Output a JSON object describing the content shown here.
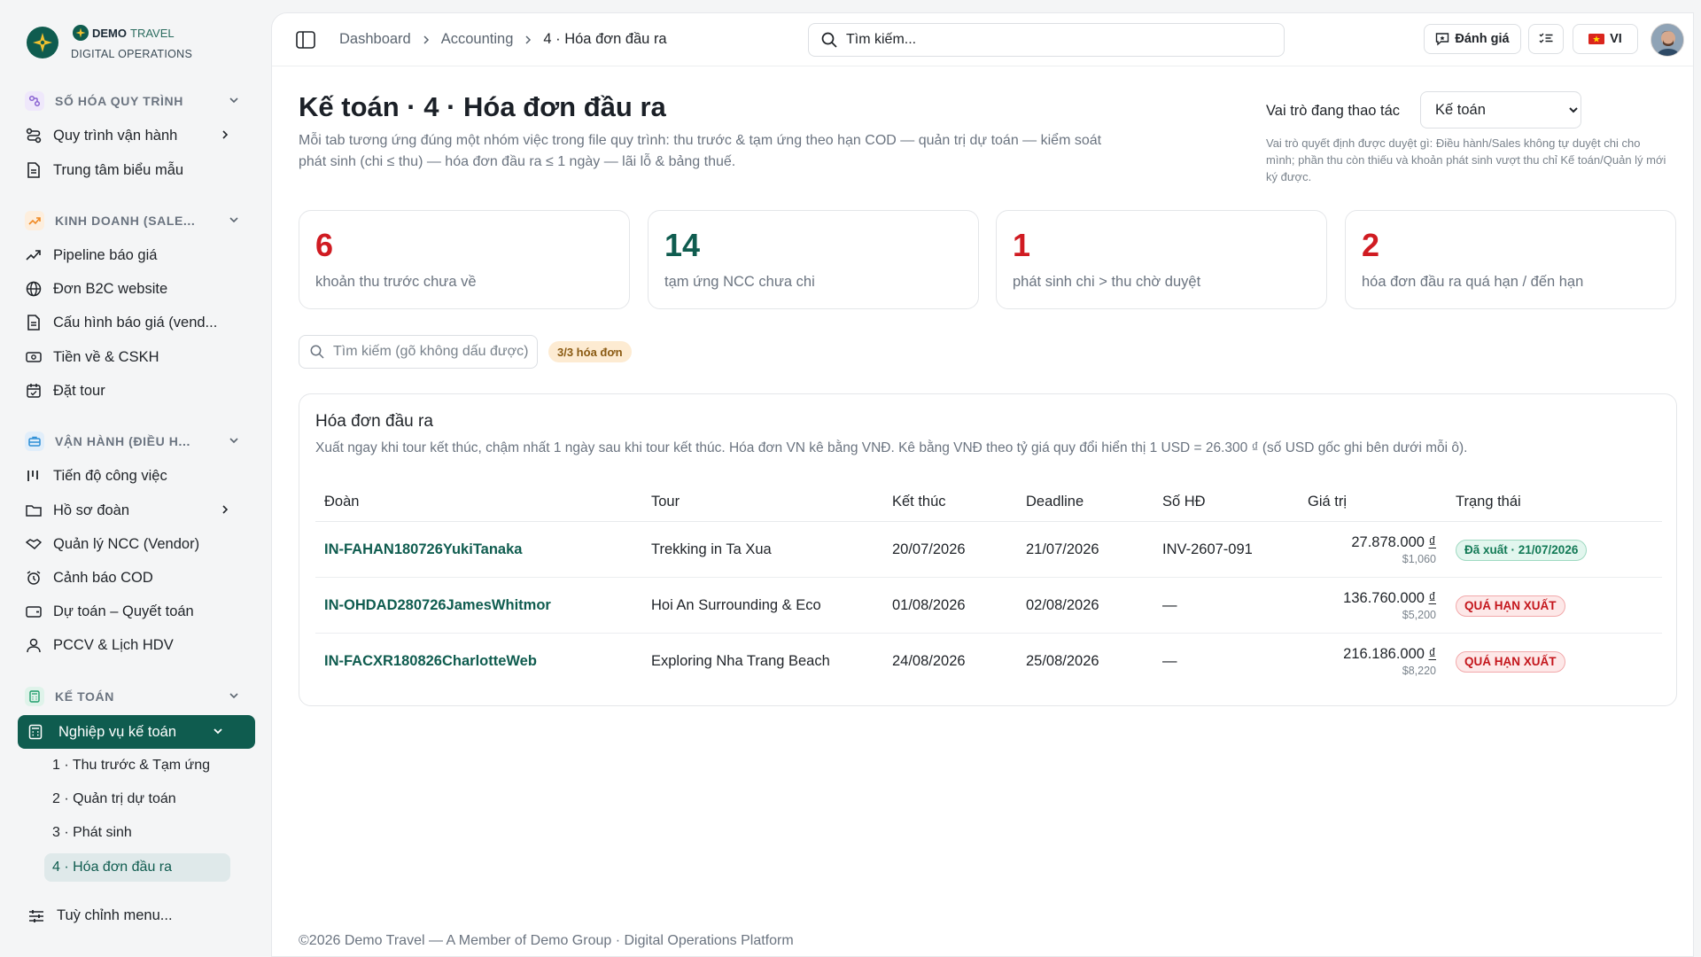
{
  "brand": {
    "name_bold": "DEMO",
    "name_light": "TRAVEL",
    "subtitle": "DIGITAL OPERATIONS"
  },
  "sidebar": {
    "sections": [
      {
        "label": "SỐ HÓA QUY TRÌNH",
        "icon": "workflow-icon",
        "color": "#8a63d2",
        "items": [
          {
            "label": "Quy trình vận hành",
            "icon": "workflow-steps-icon",
            "has_submenu": true
          },
          {
            "label": "Trung tâm biểu mẫu",
            "icon": "document-icon"
          }
        ]
      },
      {
        "label": "KINH DOANH (SALE...",
        "icon": "trend-up-icon",
        "color": "#f08a24",
        "items": [
          {
            "label": "Pipeline báo giá",
            "icon": "trend-up-icon"
          },
          {
            "label": "Đơn B2C website",
            "icon": "globe-icon"
          },
          {
            "label": "Cấu hình báo giá (vend...",
            "icon": "document-icon"
          },
          {
            "label": "Tiền về & CSKH",
            "icon": "money-icon"
          },
          {
            "label": "Đặt tour",
            "icon": "calendar-check-icon"
          }
        ]
      },
      {
        "label": "VẬN HÀNH (ĐIỀU H...",
        "icon": "briefcase-icon",
        "color": "#2f8fd6",
        "items": [
          {
            "label": "Tiến độ công việc",
            "icon": "bar-progress-icon"
          },
          {
            "label": "Hồ sơ đoàn",
            "icon": "folder-icon",
            "has_submenu": true
          },
          {
            "label": "Quản lý NCC (Vendor)",
            "icon": "handshake-icon"
          },
          {
            "label": "Cảnh báo COD",
            "icon": "alarm-icon"
          },
          {
            "label": "Dự toán – Quyết toán",
            "icon": "wallet-icon"
          },
          {
            "label": "PCCV & Lịch HDV",
            "icon": "user-icon"
          }
        ]
      },
      {
        "label": "KẾ TOÁN",
        "icon": "calculator-icon",
        "color": "#1f9d6b",
        "active_item": {
          "label": "Nghiệp vụ kế toán",
          "icon": "calculator-icon"
        },
        "subitems": [
          {
            "label": "1 · Thu trước & Tạm ứng"
          },
          {
            "label": "2 · Quản trị dự toán"
          },
          {
            "label": "3 · Phát sinh"
          },
          {
            "label": "4 · Hóa đơn đầu ra",
            "selected": true
          }
        ]
      }
    ],
    "customize_label": "Tuỳ chỉnh menu..."
  },
  "topbar": {
    "breadcrumb": [
      "Dashboard",
      "Accounting",
      "4 · Hóa đơn đầu ra"
    ],
    "search_placeholder": "Tìm kiếm...",
    "feedback_label": "Đánh giá",
    "language_label": "VI",
    "language_flag": "🇻🇳"
  },
  "page": {
    "title": "Kế toán · 4 · Hóa đơn đầu ra",
    "description": "Mỗi tab tương ứng đúng một nhóm việc trong file quy trình: thu trước & tạm ứng theo hạn COD — quản trị dự toán — kiểm soát phát sinh (chi ≤ thu) — hóa đơn đầu ra ≤ 1 ngày — lãi lỗ & bảng thuế.",
    "role_label": "Vai trò đang thao tác",
    "role_selected": "Kế toán",
    "role_options": [
      "Kế toán"
    ],
    "role_note": "Vai trò quyết định được duyệt gì: Điều hành/Sales không tự duyệt chi cho mình; phần thu còn thiếu và khoản phát sinh vượt thu chỉ Kế toán/Quản lý mới ký được."
  },
  "stats": [
    {
      "value": "6",
      "label": "khoản thu trước chưa về",
      "color": "#d01b22"
    },
    {
      "value": "14",
      "label": "tạm ứng NCC chưa chi",
      "color": "#0f5c4f"
    },
    {
      "value": "1",
      "label": "phát sinh chi > thu chờ duyệt",
      "color": "#d01b22"
    },
    {
      "value": "2",
      "label": "hóa đơn đầu ra quá hạn / đến hạn",
      "color": "#d01b22"
    }
  ],
  "filter": {
    "placeholder": "Tìm kiếm (gõ không dấu được)",
    "count_badge": "3/3 hóa đơn"
  },
  "invoices": {
    "title": "Hóa đơn đầu ra",
    "description": "Xuất ngay khi tour kết thúc, chậm nhất 1 ngày sau khi tour kết thúc. Hóa đơn VN kê bằng VNĐ. Kê bằng VNĐ theo tỷ giá quy đổi hiển thị 1 USD = 26.300 ₫ (số USD gốc ghi bên dưới mỗi ô).",
    "columns": [
      "Đoàn",
      "Tour",
      "Kết thúc",
      "Deadline",
      "Số HĐ",
      "Giá trị",
      "Trạng thái"
    ],
    "rows": [
      {
        "code": "IN-FAHAN180726YukiTanaka",
        "tour": "Trekking in Ta Xua",
        "end": "20/07/2026",
        "deadline": "21/07/2026",
        "invoice_no": "INV-2607-091",
        "vnd": "27.878.000",
        "currency": "₫",
        "usd": "$1,060",
        "status": "Đã xuất · 21/07/2026",
        "status_type": "ok"
      },
      {
        "code": "IN-OHDAD280726JamesWhitmor",
        "tour": "Hoi An Surrounding & Eco",
        "end": "01/08/2026",
        "deadline": "02/08/2026",
        "invoice_no": "—",
        "vnd": "136.760.000",
        "currency": "₫",
        "usd": "$5,200",
        "status": "QUÁ HẠN XUẤT",
        "status_type": "late"
      },
      {
        "code": "IN-FACXR180826CharlotteWeb",
        "tour": "Exploring Nha Trang Beach",
        "end": "24/08/2026",
        "deadline": "25/08/2026",
        "invoice_no": "—",
        "vnd": "216.186.000",
        "currency": "₫",
        "usd": "$8,220",
        "status": "QUÁ HẠN XUẤT",
        "status_type": "late"
      }
    ]
  },
  "footer": "©2026 Demo Travel — A Member of Demo Group · Digital Operations Platform",
  "colors": {
    "brand": "#0f5c4f",
    "danger": "#d01b22",
    "success": "#137a56"
  }
}
